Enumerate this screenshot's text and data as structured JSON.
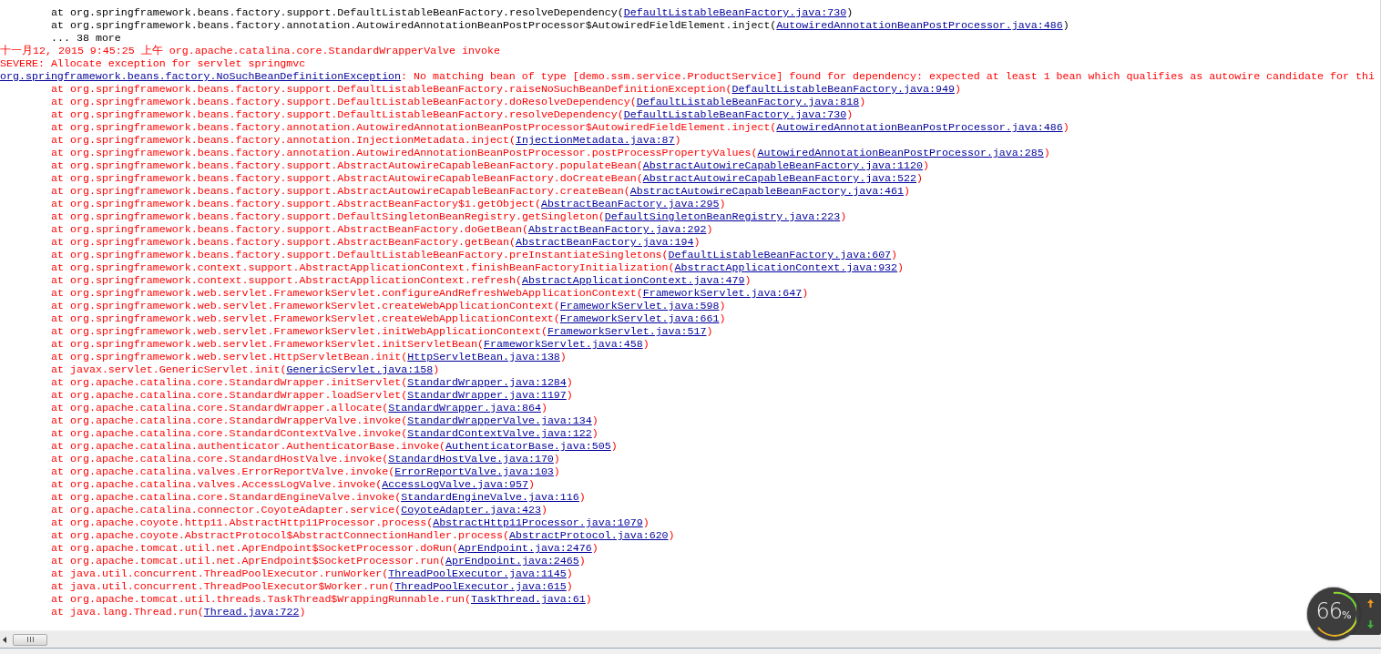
{
  "console": {
    "lines": [
      {
        "kind": "frame",
        "error": false,
        "indent": true,
        "text": "at org.springframework.beans.factory.support.DefaultListableBeanFactory.resolveDependency(",
        "link": "DefaultListableBeanFactory.java:730",
        "tail": ")"
      },
      {
        "kind": "frame",
        "error": false,
        "indent": true,
        "text": "at org.springframework.beans.factory.annotation.AutowiredAnnotationBeanPostProcessor$AutowiredFieldElement.inject(",
        "link": "AutowiredAnnotationBeanPostProcessor.java:486",
        "tail": ")"
      },
      {
        "kind": "plain",
        "error": false,
        "indent": true,
        "text": "... 38 more"
      },
      {
        "kind": "plain",
        "error": true,
        "indent": false,
        "text": "十一月12, 2015 9:45:25 上午 org.apache.catalina.core.StandardWrapperValve invoke"
      },
      {
        "kind": "plain",
        "error": true,
        "indent": false,
        "text": "SEVERE: Allocate exception for servlet springmvc"
      },
      {
        "kind": "exception",
        "error": true,
        "indent": false,
        "link": "org.springframework.beans.factory.NoSuchBeanDefinitionException",
        "tail": ": No matching bean of type [demo.ssm.service.ProductService] found for dependency: expected at least 1 bean which qualifies as autowire candidate for thi"
      },
      {
        "kind": "frame",
        "error": true,
        "indent": true,
        "text": "at org.springframework.beans.factory.support.DefaultListableBeanFactory.raiseNoSuchBeanDefinitionException(",
        "link": "DefaultListableBeanFactory.java:949",
        "tail": ")"
      },
      {
        "kind": "frame",
        "error": true,
        "indent": true,
        "text": "at org.springframework.beans.factory.support.DefaultListableBeanFactory.doResolveDependency(",
        "link": "DefaultListableBeanFactory.java:818",
        "tail": ")"
      },
      {
        "kind": "frame",
        "error": true,
        "indent": true,
        "text": "at org.springframework.beans.factory.support.DefaultListableBeanFactory.resolveDependency(",
        "link": "DefaultListableBeanFactory.java:730",
        "tail": ")"
      },
      {
        "kind": "frame",
        "error": true,
        "indent": true,
        "text": "at org.springframework.beans.factory.annotation.AutowiredAnnotationBeanPostProcessor$AutowiredFieldElement.inject(",
        "link": "AutowiredAnnotationBeanPostProcessor.java:486",
        "tail": ")"
      },
      {
        "kind": "frame",
        "error": true,
        "indent": true,
        "text": "at org.springframework.beans.factory.annotation.InjectionMetadata.inject(",
        "link": "InjectionMetadata.java:87",
        "tail": ")"
      },
      {
        "kind": "frame",
        "error": true,
        "indent": true,
        "text": "at org.springframework.beans.factory.annotation.AutowiredAnnotationBeanPostProcessor.postProcessPropertyValues(",
        "link": "AutowiredAnnotationBeanPostProcessor.java:285",
        "tail": ")"
      },
      {
        "kind": "frame",
        "error": true,
        "indent": true,
        "text": "at org.springframework.beans.factory.support.AbstractAutowireCapableBeanFactory.populateBean(",
        "link": "AbstractAutowireCapableBeanFactory.java:1120",
        "tail": ")"
      },
      {
        "kind": "frame",
        "error": true,
        "indent": true,
        "text": "at org.springframework.beans.factory.support.AbstractAutowireCapableBeanFactory.doCreateBean(",
        "link": "AbstractAutowireCapableBeanFactory.java:522",
        "tail": ")"
      },
      {
        "kind": "frame",
        "error": true,
        "indent": true,
        "text": "at org.springframework.beans.factory.support.AbstractAutowireCapableBeanFactory.createBean(",
        "link": "AbstractAutowireCapableBeanFactory.java:461",
        "tail": ")"
      },
      {
        "kind": "frame",
        "error": true,
        "indent": true,
        "text": "at org.springframework.beans.factory.support.AbstractBeanFactory$1.getObject(",
        "link": "AbstractBeanFactory.java:295",
        "tail": ")"
      },
      {
        "kind": "frame",
        "error": true,
        "indent": true,
        "text": "at org.springframework.beans.factory.support.DefaultSingletonBeanRegistry.getSingleton(",
        "link": "DefaultSingletonBeanRegistry.java:223",
        "tail": ")"
      },
      {
        "kind": "frame",
        "error": true,
        "indent": true,
        "text": "at org.springframework.beans.factory.support.AbstractBeanFactory.doGetBean(",
        "link": "AbstractBeanFactory.java:292",
        "tail": ")"
      },
      {
        "kind": "frame",
        "error": true,
        "indent": true,
        "text": "at org.springframework.beans.factory.support.AbstractBeanFactory.getBean(",
        "link": "AbstractBeanFactory.java:194",
        "tail": ")"
      },
      {
        "kind": "frame",
        "error": true,
        "indent": true,
        "text": "at org.springframework.beans.factory.support.DefaultListableBeanFactory.preInstantiateSingletons(",
        "link": "DefaultListableBeanFactory.java:607",
        "tail": ")"
      },
      {
        "kind": "frame",
        "error": true,
        "indent": true,
        "text": "at org.springframework.context.support.AbstractApplicationContext.finishBeanFactoryInitialization(",
        "link": "AbstractApplicationContext.java:932",
        "tail": ")"
      },
      {
        "kind": "frame",
        "error": true,
        "indent": true,
        "text": "at org.springframework.context.support.AbstractApplicationContext.refresh(",
        "link": "AbstractApplicationContext.java:479",
        "tail": ")"
      },
      {
        "kind": "frame",
        "error": true,
        "indent": true,
        "text": "at org.springframework.web.servlet.FrameworkServlet.configureAndRefreshWebApplicationContext(",
        "link": "FrameworkServlet.java:647",
        "tail": ")"
      },
      {
        "kind": "frame",
        "error": true,
        "indent": true,
        "text": "at org.springframework.web.servlet.FrameworkServlet.createWebApplicationContext(",
        "link": "FrameworkServlet.java:598",
        "tail": ")"
      },
      {
        "kind": "frame",
        "error": true,
        "indent": true,
        "text": "at org.springframework.web.servlet.FrameworkServlet.createWebApplicationContext(",
        "link": "FrameworkServlet.java:661",
        "tail": ")"
      },
      {
        "kind": "frame",
        "error": true,
        "indent": true,
        "text": "at org.springframework.web.servlet.FrameworkServlet.initWebApplicationContext(",
        "link": "FrameworkServlet.java:517",
        "tail": ")"
      },
      {
        "kind": "frame",
        "error": true,
        "indent": true,
        "text": "at org.springframework.web.servlet.FrameworkServlet.initServletBean(",
        "link": "FrameworkServlet.java:458",
        "tail": ")"
      },
      {
        "kind": "frame",
        "error": true,
        "indent": true,
        "text": "at org.springframework.web.servlet.HttpServletBean.init(",
        "link": "HttpServletBean.java:138",
        "tail": ")"
      },
      {
        "kind": "frame",
        "error": true,
        "indent": true,
        "text": "at javax.servlet.GenericServlet.init(",
        "link": "GenericServlet.java:158",
        "tail": ")"
      },
      {
        "kind": "frame",
        "error": true,
        "indent": true,
        "text": "at org.apache.catalina.core.StandardWrapper.initServlet(",
        "link": "StandardWrapper.java:1284",
        "tail": ")"
      },
      {
        "kind": "frame",
        "error": true,
        "indent": true,
        "text": "at org.apache.catalina.core.StandardWrapper.loadServlet(",
        "link": "StandardWrapper.java:1197",
        "tail": ")"
      },
      {
        "kind": "frame",
        "error": true,
        "indent": true,
        "text": "at org.apache.catalina.core.StandardWrapper.allocate(",
        "link": "StandardWrapper.java:864",
        "tail": ")"
      },
      {
        "kind": "frame",
        "error": true,
        "indent": true,
        "text": "at org.apache.catalina.core.StandardWrapperValve.invoke(",
        "link": "StandardWrapperValve.java:134",
        "tail": ")"
      },
      {
        "kind": "frame",
        "error": true,
        "indent": true,
        "text": "at org.apache.catalina.core.StandardContextValve.invoke(",
        "link": "StandardContextValve.java:122",
        "tail": ")"
      },
      {
        "kind": "frame",
        "error": true,
        "indent": true,
        "text": "at org.apache.catalina.authenticator.AuthenticatorBase.invoke(",
        "link": "AuthenticatorBase.java:505",
        "tail": ")"
      },
      {
        "kind": "frame",
        "error": true,
        "indent": true,
        "text": "at org.apache.catalina.core.StandardHostValve.invoke(",
        "link": "StandardHostValve.java:170",
        "tail": ")"
      },
      {
        "kind": "frame",
        "error": true,
        "indent": true,
        "text": "at org.apache.catalina.valves.ErrorReportValve.invoke(",
        "link": "ErrorReportValve.java:103",
        "tail": ")"
      },
      {
        "kind": "frame",
        "error": true,
        "indent": true,
        "text": "at org.apache.catalina.valves.AccessLogValve.invoke(",
        "link": "AccessLogValve.java:957",
        "tail": ")"
      },
      {
        "kind": "frame",
        "error": true,
        "indent": true,
        "text": "at org.apache.catalina.core.StandardEngineValve.invoke(",
        "link": "StandardEngineValve.java:116",
        "tail": ")"
      },
      {
        "kind": "frame",
        "error": true,
        "indent": true,
        "text": "at org.apache.catalina.connector.CoyoteAdapter.service(",
        "link": "CoyoteAdapter.java:423",
        "tail": ")"
      },
      {
        "kind": "frame",
        "error": true,
        "indent": true,
        "text": "at org.apache.coyote.http11.AbstractHttp11Processor.process(",
        "link": "AbstractHttp11Processor.java:1079",
        "tail": ")"
      },
      {
        "kind": "frame",
        "error": true,
        "indent": true,
        "text": "at org.apache.coyote.AbstractProtocol$AbstractConnectionHandler.process(",
        "link": "AbstractProtocol.java:620",
        "tail": ")"
      },
      {
        "kind": "frame",
        "error": true,
        "indent": true,
        "text": "at org.apache.tomcat.util.net.AprEndpoint$SocketProcessor.doRun(",
        "link": "AprEndpoint.java:2476",
        "tail": ")"
      },
      {
        "kind": "frame",
        "error": true,
        "indent": true,
        "text": "at org.apache.tomcat.util.net.AprEndpoint$SocketProcessor.run(",
        "link": "AprEndpoint.java:2465",
        "tail": ")"
      },
      {
        "kind": "frame",
        "error": true,
        "indent": true,
        "text": "at java.util.concurrent.ThreadPoolExecutor.runWorker(",
        "link": "ThreadPoolExecutor.java:1145",
        "tail": ")"
      },
      {
        "kind": "frame",
        "error": true,
        "indent": true,
        "text": "at java.util.concurrent.ThreadPoolExecutor$Worker.run(",
        "link": "ThreadPoolExecutor.java:615",
        "tail": ")"
      },
      {
        "kind": "frame",
        "error": true,
        "indent": true,
        "text": "at org.apache.tomcat.util.threads.TaskThread$WrappingRunnable.run(",
        "link": "TaskThread.java:61",
        "tail": ")"
      },
      {
        "kind": "frame",
        "error": true,
        "indent": true,
        "text": "at java.lang.Thread.run(",
        "link": "Thread.java:722",
        "tail": ")"
      }
    ]
  },
  "traffic_widget": {
    "value": "66",
    "unit": "%"
  }
}
